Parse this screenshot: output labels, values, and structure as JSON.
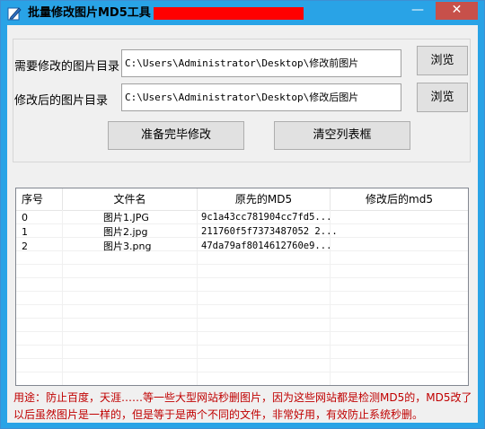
{
  "window": {
    "title": "批量修改图片MD5工具"
  },
  "controls": {
    "minimize": "—",
    "close": "✕"
  },
  "fields": {
    "source": {
      "label": "需要修改的图片目录",
      "value": "C:\\Users\\Administrator\\Desktop\\修改前图片",
      "browse": "浏览"
    },
    "target": {
      "label": "修改后的图片目录",
      "value": "C:\\Users\\Administrator\\Desktop\\修改后图片",
      "browse": "浏览"
    }
  },
  "actions": {
    "start": "准备完毕修改",
    "clear": "清空列表框"
  },
  "table": {
    "columns": [
      "序号",
      "文件名",
      "原先的MD5",
      "修改后的md5"
    ],
    "rows": [
      [
        "0",
        "图片1.JPG",
        "9c1a43cc781904cc7fd5...",
        ""
      ],
      [
        "1",
        "图片2.jpg",
        "211760f5f7373487052 2...",
        ""
      ],
      [
        "2",
        "图片3.png",
        "47da79af8014612760e9...",
        ""
      ]
    ]
  },
  "note": "用途：防止百度，天涯……等一些大型网站秒删图片，因为这些网站都是检测MD5的，MD5改了以后虽然图片是一样的，但是等于是两个不同的文件，非常好用，有效防止系统秒删。"
}
